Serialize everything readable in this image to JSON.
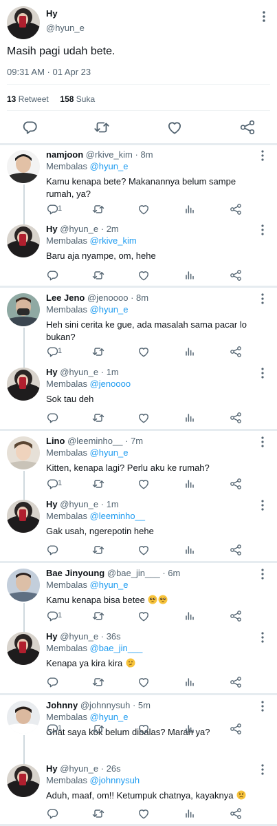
{
  "main_tweet": {
    "name": "Hy",
    "handle": "@hyun_e",
    "text": "Masih pagi udah bete.",
    "time": "09:31 AM · 01 Apr 23",
    "retweets": "13",
    "retweets_label": "Retweet",
    "likes": "158",
    "likes_label": "Suka"
  },
  "replying_label": "Membalas",
  "replies": [
    {
      "name": "namjoon",
      "handle": "@rkive_kim",
      "age": "8m",
      "to": "@hyun_e",
      "text": "Kamu kenapa bete? Makanannya belum sampe rumah, ya?",
      "reply_count": "1",
      "avatar": "namjoon"
    },
    {
      "name": "Hy",
      "handle": "@hyun_e",
      "age": "2m",
      "to": "@rkive_kim",
      "text": "Baru aja nyampe, om, hehe",
      "reply_count": "",
      "avatar": "hy"
    },
    {
      "name": "Lee Jeno",
      "handle": "@jenoooo",
      "age": "8m",
      "to": "@hyun_e",
      "text": "Heh sini cerita ke gue, ada masalah sama pacar lo bukan?",
      "reply_count": "1",
      "avatar": "jeno"
    },
    {
      "name": "Hy",
      "handle": "@hyun_e",
      "age": "1m",
      "to": "@jenoooo",
      "text": "Sok tau deh",
      "reply_count": "",
      "avatar": "hy"
    },
    {
      "name": "Lino",
      "handle": "@leeminho__",
      "age": "7m",
      "to": "@hyun_e",
      "text": "Kitten, kenapa lagi? Perlu aku ke rumah?",
      "reply_count": "1",
      "avatar": "lino"
    },
    {
      "name": "Hy",
      "handle": "@hyun_e",
      "age": "1m",
      "to": "@leeminho__",
      "text": "Gak usah, ngerepotin hehe",
      "reply_count": "",
      "avatar": "hy"
    },
    {
      "name": "Bae Jinyoung",
      "handle": "@bae_jin___",
      "age": "6m",
      "to": "@hyun_e",
      "text": "Kamu kenapa bisa betee",
      "emoji": "pleading pleading",
      "reply_count": "1",
      "avatar": "bae"
    },
    {
      "name": "Hy",
      "handle": "@hyun_e",
      "age": "36s",
      "to": "@bae_jin___",
      "text": "Kenapa ya kira kira",
      "emoji": "thinking",
      "reply_count": "",
      "avatar": "hy"
    },
    {
      "name": "Johnny",
      "handle": "@johnnysuh",
      "age": "5m",
      "to": "@hyun_e",
      "text": "Chat saya kok belum dibalas? Marah ya?",
      "reply_count": "1",
      "avatar": "johnny"
    },
    {
      "name": "Hy",
      "handle": "@hyun_e",
      "age": "26s",
      "to": "@johnnysuh",
      "text": "Aduh, maaf, om!! Ketumpuk chatnya, kayaknya",
      "emoji": "sad",
      "reply_count": "",
      "avatar": "hy"
    }
  ],
  "icons": {
    "reply": "reply-icon",
    "retweet": "retweet-icon",
    "like": "heart-icon",
    "analytics": "analytics-icon",
    "share": "share-icon",
    "more": "more-icon"
  },
  "colors": {
    "link": "#1d9bf0",
    "secondary": "#536471",
    "separator": "#e6ecf0"
  }
}
